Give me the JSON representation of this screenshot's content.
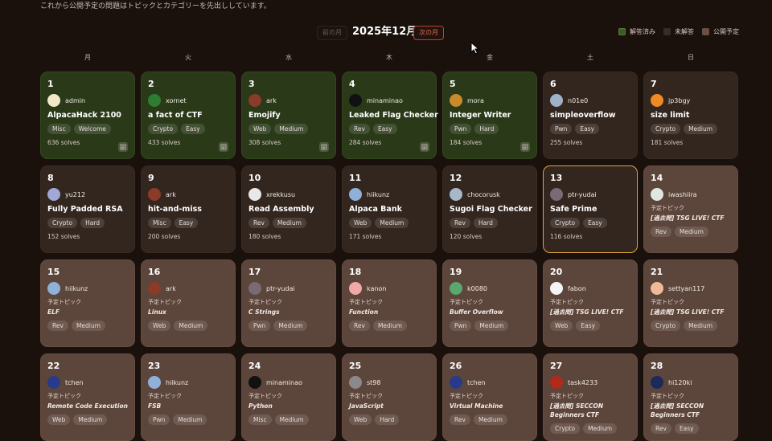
{
  "intro": "これから公開予定の問題はトピックとカテゴリーを先出ししています。",
  "header": {
    "prev_label": "前の月",
    "month_title": "2025年12月",
    "next_label": "次の月"
  },
  "legend": [
    {
      "label": "解答済み",
      "color": "#3c5a2a"
    },
    {
      "label": "未解答",
      "color": "#3a2c24"
    },
    {
      "label": "公開予定",
      "color": "#6a4f44"
    }
  ],
  "weekdays": [
    "月",
    "火",
    "水",
    "木",
    "金",
    "土",
    "日"
  ],
  "colors": {
    "accent": "#e06a4c",
    "today_border": "#e0a540",
    "solved": "#2a3a19",
    "unsolved": "#33261f",
    "scheduled": "#5c453b"
  },
  "days": [
    {
      "day": "1",
      "status": "solved",
      "author": "admin",
      "avatar_color": "#f3e8c6",
      "title": "AlpacaHack 2100",
      "tags": [
        "Misc",
        "Welcome"
      ],
      "solves": "636 solves",
      "writeup": true
    },
    {
      "day": "2",
      "status": "solved",
      "author": "xornet",
      "avatar_color": "#2e7d32",
      "title": "a fact of CTF",
      "tags": [
        "Crypto",
        "Easy"
      ],
      "solves": "433 solves",
      "writeup": true
    },
    {
      "day": "3",
      "status": "solved",
      "author": "ark",
      "avatar_color": "#8a3b2a",
      "title": "Emojify",
      "tags": [
        "Web",
        "Medium"
      ],
      "solves": "308 solves",
      "writeup": true
    },
    {
      "day": "4",
      "status": "solved",
      "author": "minaminao",
      "avatar_color": "#111111",
      "title": "Leaked Flag Checker",
      "tags": [
        "Rev",
        "Easy"
      ],
      "solves": "284 solves",
      "writeup": true
    },
    {
      "day": "5",
      "status": "solved",
      "author": "mora",
      "avatar_color": "#c98a2a",
      "title": "Integer Writer",
      "tags": [
        "Pwn",
        "Hard"
      ],
      "solves": "184 solves",
      "writeup": true
    },
    {
      "day": "6",
      "status": "unsolved",
      "author": "n01e0",
      "avatar_color": "#9fb3c8",
      "title": "simpleoverflow",
      "tags": [
        "Pwn",
        "Easy"
      ],
      "solves": "255 solves",
      "writeup": false
    },
    {
      "day": "7",
      "status": "unsolved",
      "author": "jp3bgy",
      "avatar_color": "#f08a24",
      "title": "size limit",
      "tags": [
        "Crypto",
        "Medium"
      ],
      "solves": "181 solves",
      "writeup": false
    },
    {
      "day": "8",
      "status": "unsolved",
      "author": "yu212",
      "avatar_color": "#9fa8d6",
      "title": "Fully Padded RSA",
      "tags": [
        "Crypto",
        "Hard"
      ],
      "solves": "152 solves",
      "writeup": false
    },
    {
      "day": "9",
      "status": "unsolved",
      "author": "ark",
      "avatar_color": "#8a3b2a",
      "title": "hit-and-miss",
      "tags": [
        "Misc",
        "Easy"
      ],
      "solves": "200 solves",
      "writeup": false
    },
    {
      "day": "10",
      "status": "unsolved",
      "author": "xrekkusu",
      "avatar_color": "#e8e8e8",
      "title": "Read Assembly",
      "tags": [
        "Rev",
        "Medium"
      ],
      "solves": "180 solves",
      "writeup": false
    },
    {
      "day": "11",
      "status": "unsolved",
      "author": "hiikunz",
      "avatar_color": "#8fb0d8",
      "title": "Alpaca Bank",
      "tags": [
        "Web",
        "Medium"
      ],
      "solves": "171 solves",
      "writeup": false
    },
    {
      "day": "12",
      "status": "unsolved",
      "author": "chocorusk",
      "avatar_color": "#a8b8c8",
      "title": "Sugoi Flag Checker",
      "tags": [
        "Rev",
        "Hard"
      ],
      "solves": "120 solves",
      "writeup": false
    },
    {
      "day": "13",
      "status": "unsolved",
      "today": true,
      "author": "ptr-yudai",
      "avatar_color": "#7a6a74",
      "title": "Safe Prime",
      "tags": [
        "Crypto",
        "Easy"
      ],
      "solves": "116 solves",
      "writeup": false
    },
    {
      "day": "14",
      "status": "scheduled",
      "author": "iwashiira",
      "avatar_color": "#dfe8e0",
      "sched_label": "予定トピック",
      "topic": "[過去問] TSG LIVE! CTF",
      "tags": [
        "Rev",
        "Medium"
      ]
    },
    {
      "day": "15",
      "status": "scheduled",
      "author": "hiikunz",
      "avatar_color": "#8fb0d8",
      "sched_label": "予定トピック",
      "topic": "ELF",
      "tags": [
        "Rev",
        "Medium"
      ]
    },
    {
      "day": "16",
      "status": "scheduled",
      "author": "ark",
      "avatar_color": "#8a3b2a",
      "sched_label": "予定トピック",
      "topic": "Linux",
      "tags": [
        "Web",
        "Medium"
      ]
    },
    {
      "day": "17",
      "status": "scheduled",
      "author": "ptr-yudai",
      "avatar_color": "#7a6a74",
      "sched_label": "予定トピック",
      "topic": "C Strings",
      "tags": [
        "Pwn",
        "Medium"
      ]
    },
    {
      "day": "18",
      "status": "scheduled",
      "author": "kanon",
      "avatar_color": "#f2a8a8",
      "sched_label": "予定トピック",
      "topic": "Function",
      "tags": [
        "Rev",
        "Medium"
      ]
    },
    {
      "day": "19",
      "status": "scheduled",
      "author": "k0080",
      "avatar_color": "#5aa870",
      "sched_label": "予定トピック",
      "topic": "Buffer Overflow",
      "tags": [
        "Pwn",
        "Medium"
      ]
    },
    {
      "day": "20",
      "status": "scheduled",
      "author": "fabon",
      "avatar_color": "#f4f4f4",
      "sched_label": "予定トピック",
      "topic": "[過去問] TSG LIVE! CTF",
      "tags": [
        "Web",
        "Easy"
      ]
    },
    {
      "day": "21",
      "status": "scheduled",
      "author": "settyan117",
      "avatar_color": "#f2b89a",
      "sched_label": "予定トピック",
      "topic": "[過去問] TSG LIVE! CTF",
      "tags": [
        "Crypto",
        "Medium"
      ]
    },
    {
      "day": "22",
      "status": "scheduled",
      "author": "tchen",
      "avatar_color": "#2a3a8a",
      "sched_label": "予定トピック",
      "topic": "Remote Code Execution",
      "tags": [
        "Web",
        "Medium"
      ]
    },
    {
      "day": "23",
      "status": "scheduled",
      "author": "hiikunz",
      "avatar_color": "#8fb0d8",
      "sched_label": "予定トピック",
      "topic": "FSB",
      "tags": [
        "Pwn",
        "Medium"
      ]
    },
    {
      "day": "24",
      "status": "scheduled",
      "author": "minaminao",
      "avatar_color": "#111111",
      "sched_label": "予定トピック",
      "topic": "Python",
      "tags": [
        "Misc",
        "Medium"
      ]
    },
    {
      "day": "25",
      "status": "scheduled",
      "author": "st98",
      "avatar_color": "#8a8a8a",
      "sched_label": "予定トピック",
      "topic": "JavaScript",
      "tags": [
        "Web",
        "Hard"
      ]
    },
    {
      "day": "26",
      "status": "scheduled",
      "author": "tchen",
      "avatar_color": "#2a3a8a",
      "sched_label": "予定トピック",
      "topic": "Virtual Machine",
      "tags": [
        "Rev",
        "Medium"
      ]
    },
    {
      "day": "27",
      "status": "scheduled",
      "author": "task4233",
      "avatar_color": "#b02a1a",
      "sched_label": "予定トピック",
      "topic": "[過去問] SECCON Beginners CTF",
      "tags": [
        "Crypto",
        "Medium"
      ]
    },
    {
      "day": "28",
      "status": "scheduled",
      "author": "hi120ki",
      "avatar_color": "#1a2a5a",
      "sched_label": "予定トピック",
      "topic": "[過去問] SECCON Beginners CTF",
      "tags": [
        "Rev",
        "Easy"
      ]
    }
  ]
}
